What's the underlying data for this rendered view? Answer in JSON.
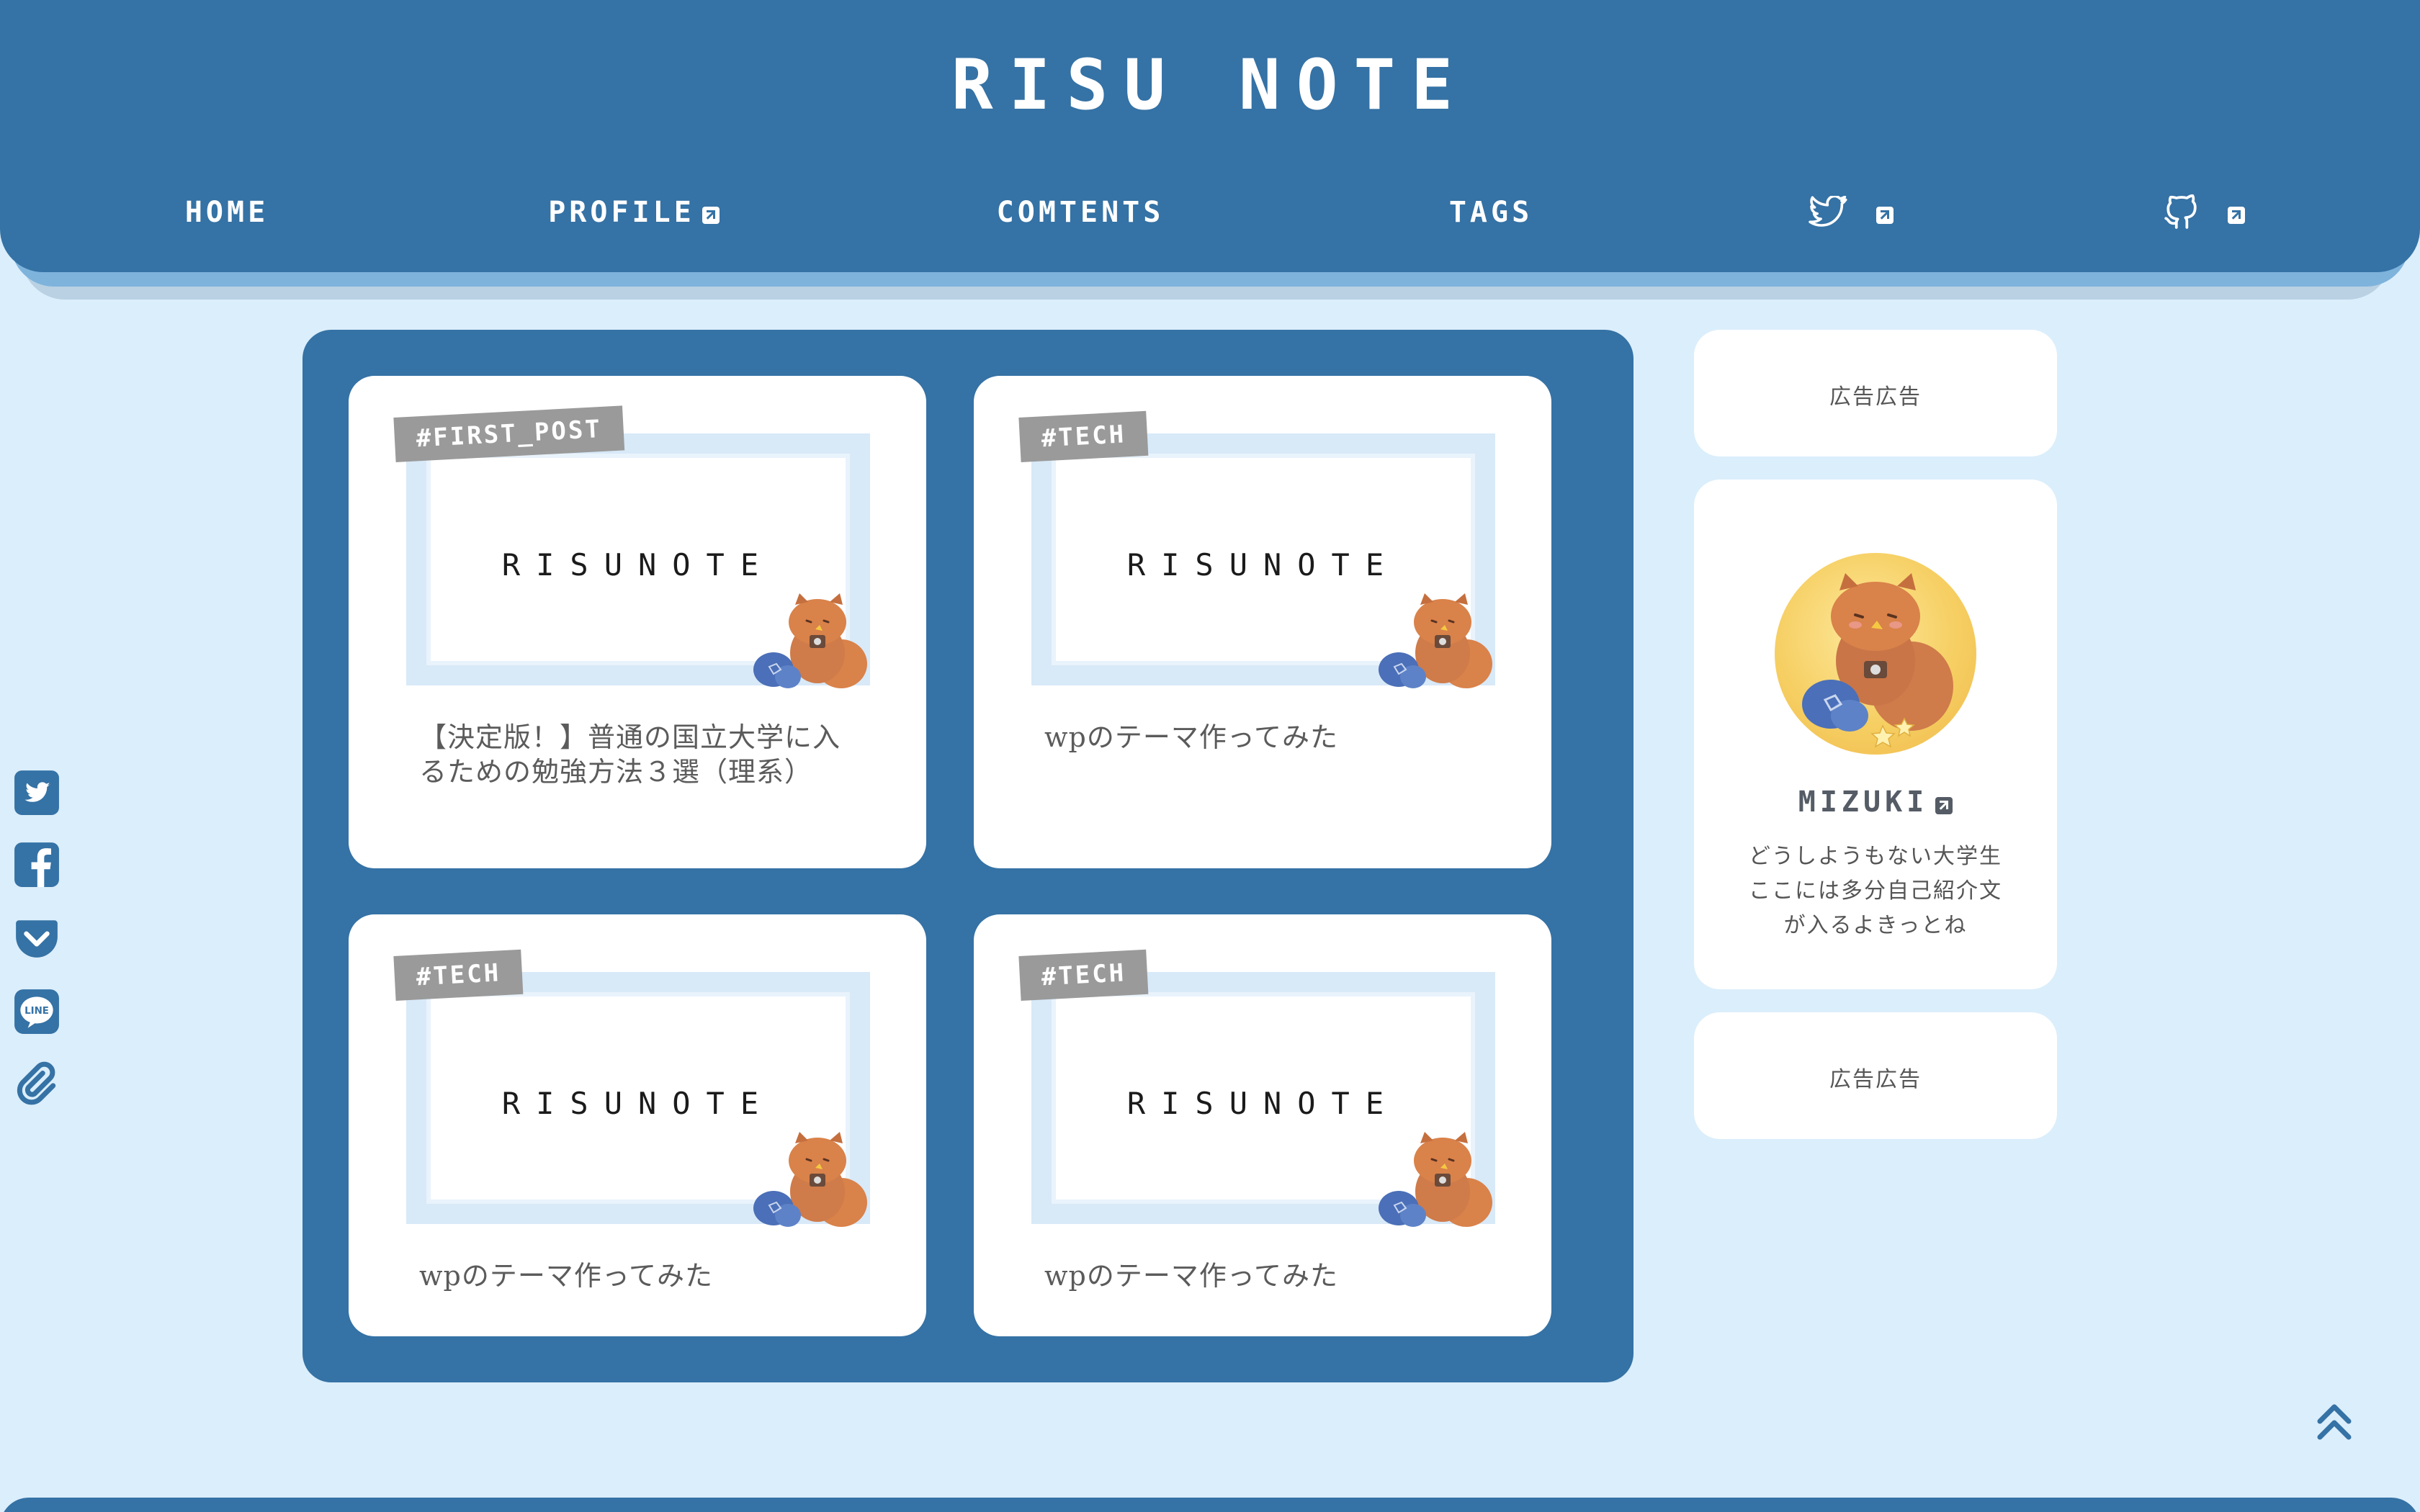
{
  "site": {
    "title": "RISU NOTE"
  },
  "nav": [
    {
      "label": "HOME",
      "external": false
    },
    {
      "label": "PROFILE",
      "external": true
    },
    {
      "label": "COMTENTS",
      "external": false
    },
    {
      "label": "TAGS",
      "external": false
    },
    {
      "icon": "twitter-icon",
      "external": true
    },
    {
      "icon": "github-icon",
      "external": true
    }
  ],
  "cards": [
    {
      "tag": "#FIRST_POST",
      "thumb_text": "RISUNOTE",
      "title": "【決定版！】普通の国立大学に入るための勉強方法３選（理系）"
    },
    {
      "tag": "#TECH",
      "thumb_text": "RISUNOTE",
      "title": "wpのテーマ作ってみた"
    },
    {
      "tag": "#TECH",
      "thumb_text": "RISUNOTE",
      "title": "wpのテーマ作ってみた"
    },
    {
      "tag": "#TECH",
      "thumb_text": "RISUNOTE",
      "title": "wpのテーマ作ってみた"
    }
  ],
  "sidebar": {
    "ad_top": "広告広告",
    "profile": {
      "name": "MIZUKI",
      "bio_lines": [
        "どうしようもない大学生",
        "ここには多分自己紹介文",
        "が入るよきっとね"
      ]
    },
    "ad_bottom": "広告広告"
  },
  "share": [
    "twitter-share-icon",
    "facebook-share-icon",
    "pocket-share-icon",
    "line-share-icon",
    "copy-link-icon"
  ],
  "colors": {
    "primary": "#3572a5",
    "background": "#dbeefb",
    "tag": "#9a9a9a",
    "card": "#ffffff"
  }
}
